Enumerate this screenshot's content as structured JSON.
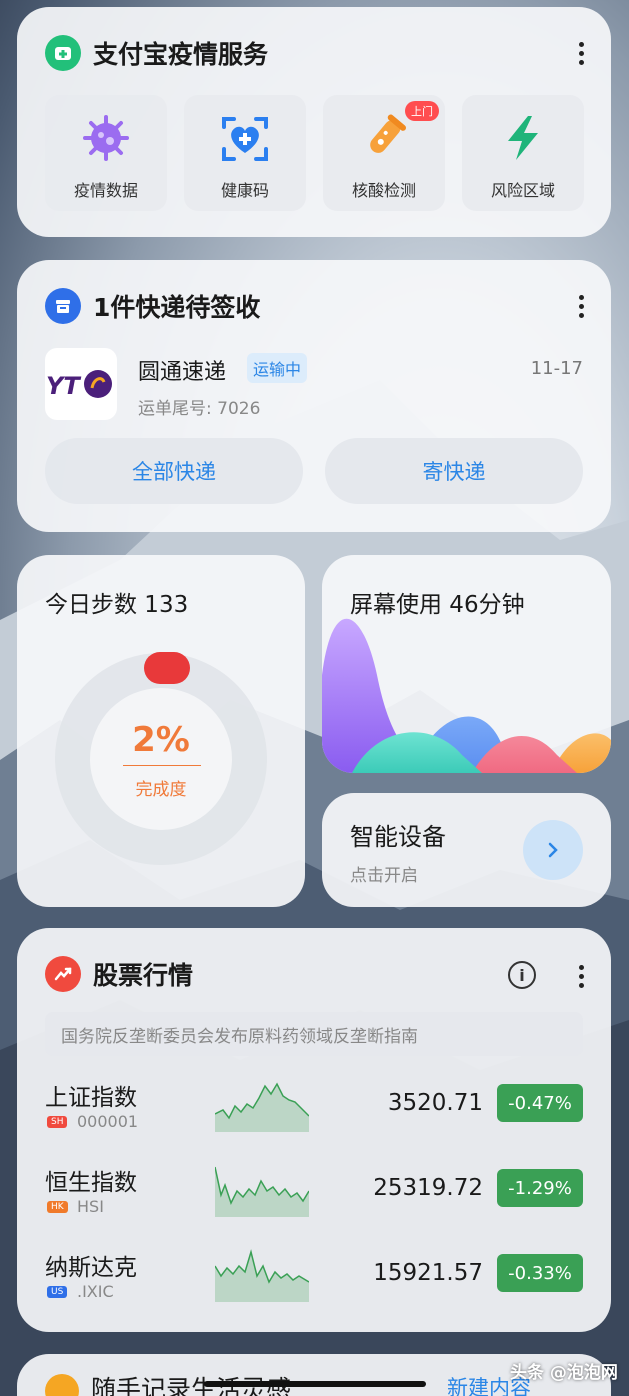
{
  "epidemic": {
    "title": "支付宝疫情服务",
    "tiles": [
      {
        "label": "疫情数据",
        "icon": "virus-icon"
      },
      {
        "label": "健康码",
        "icon": "health-code-icon"
      },
      {
        "label": "核酸检测",
        "icon": "test-tube-icon",
        "badge": "上门"
      },
      {
        "label": "风险区域",
        "icon": "lightning-icon"
      }
    ]
  },
  "express": {
    "title": "1件快递待签收",
    "courier": "圆通速递",
    "status": "运输中",
    "date": "11-17",
    "tracking": "运单尾号: 7026",
    "logo_text": "YTO",
    "btn_all": "全部快递",
    "btn_send": "寄快递"
  },
  "steps": {
    "title": "今日步数 133",
    "percent": "2%",
    "percent_label": "完成度",
    "progress": 0.02
  },
  "screen_time": {
    "title": "屏幕使用 46分钟"
  },
  "smart_devices": {
    "title": "智能设备",
    "subtitle": "点击开启"
  },
  "stocks": {
    "title": "股票行情",
    "news": "国务院反垄断委员会发布原料药领域反垄断指南",
    "rows": [
      {
        "name": "上证指数",
        "market": "SH",
        "code": "000001",
        "price": "3520.71",
        "change": "-0.47%"
      },
      {
        "name": "恒生指数",
        "market": "HK",
        "code": "HSI",
        "price": "25319.72",
        "change": "-1.29%"
      },
      {
        "name": "纳斯达克",
        "market": "US",
        "code": ".IXIC",
        "price": "15921.57",
        "change": "-0.33%"
      }
    ]
  },
  "peek": {
    "title": "随手记录生活灵感",
    "action": "新建内容"
  },
  "watermark": "头条 @泡泡网",
  "colors": {
    "accent_blue": "#2b86e6",
    "stock_green": "#3aa055",
    "progress_orange": "#f07a3a",
    "knob_red": "#e8393a"
  }
}
